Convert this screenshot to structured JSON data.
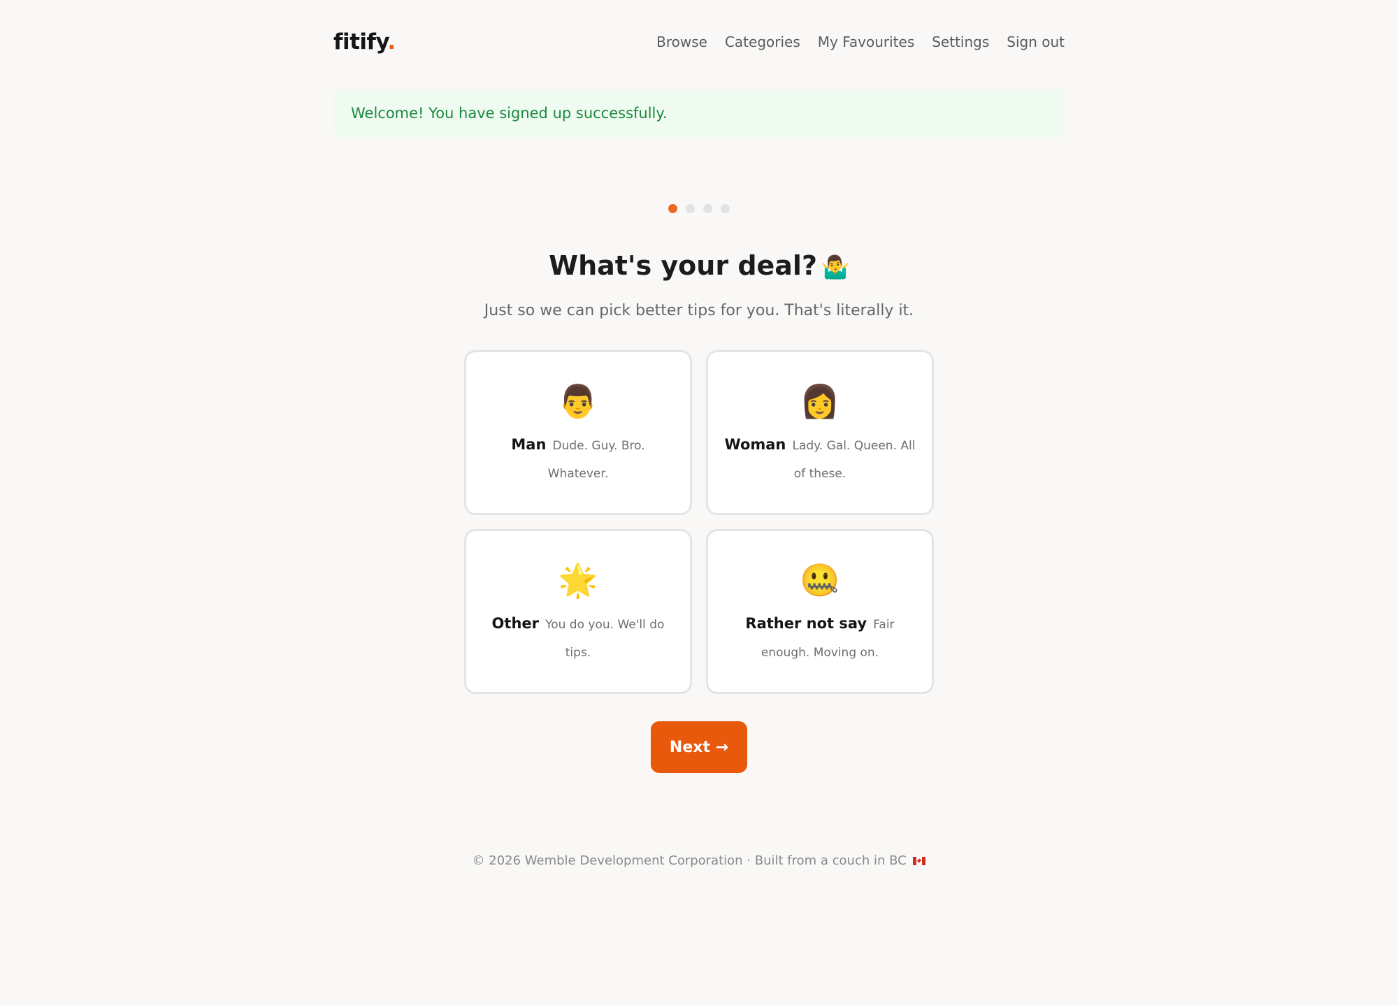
{
  "header": {
    "logo_text": "fitify",
    "logo_dot": ".",
    "nav": [
      "Browse",
      "Categories",
      "My Favourites",
      "Settings",
      "Sign out"
    ]
  },
  "flash": {
    "message": "Welcome! You have signed up successfully."
  },
  "progress": {
    "current_step": 1,
    "total_steps": 4
  },
  "main": {
    "title": "What's your deal?",
    "title_emoji": "🤷‍♂️",
    "subtitle": "Just so we can pick better tips for you. That's literally it.",
    "options": [
      {
        "emoji": "👨",
        "label": "Man",
        "desc": "Dude. Guy. Bro. Whatever."
      },
      {
        "emoji": "👩",
        "label": "Woman",
        "desc": "Lady. Gal. Queen. All of these."
      },
      {
        "emoji": "🌟",
        "label": "Other",
        "desc": "You do you. We'll do tips."
      },
      {
        "emoji": "🤐",
        "label": "Rather not say",
        "desc": "Fair enough. Moving on."
      }
    ],
    "next_label": "Next →"
  },
  "footer": {
    "text": "© 2026 Wemble Development Corporation · Built from a couch in BC",
    "flag_icon": "canada-flag-icon"
  },
  "colors": {
    "accent": "#e8590c",
    "background": "#f9f8f6",
    "flash_bg": "#effbf1",
    "flash_text": "#1b8a3f"
  }
}
